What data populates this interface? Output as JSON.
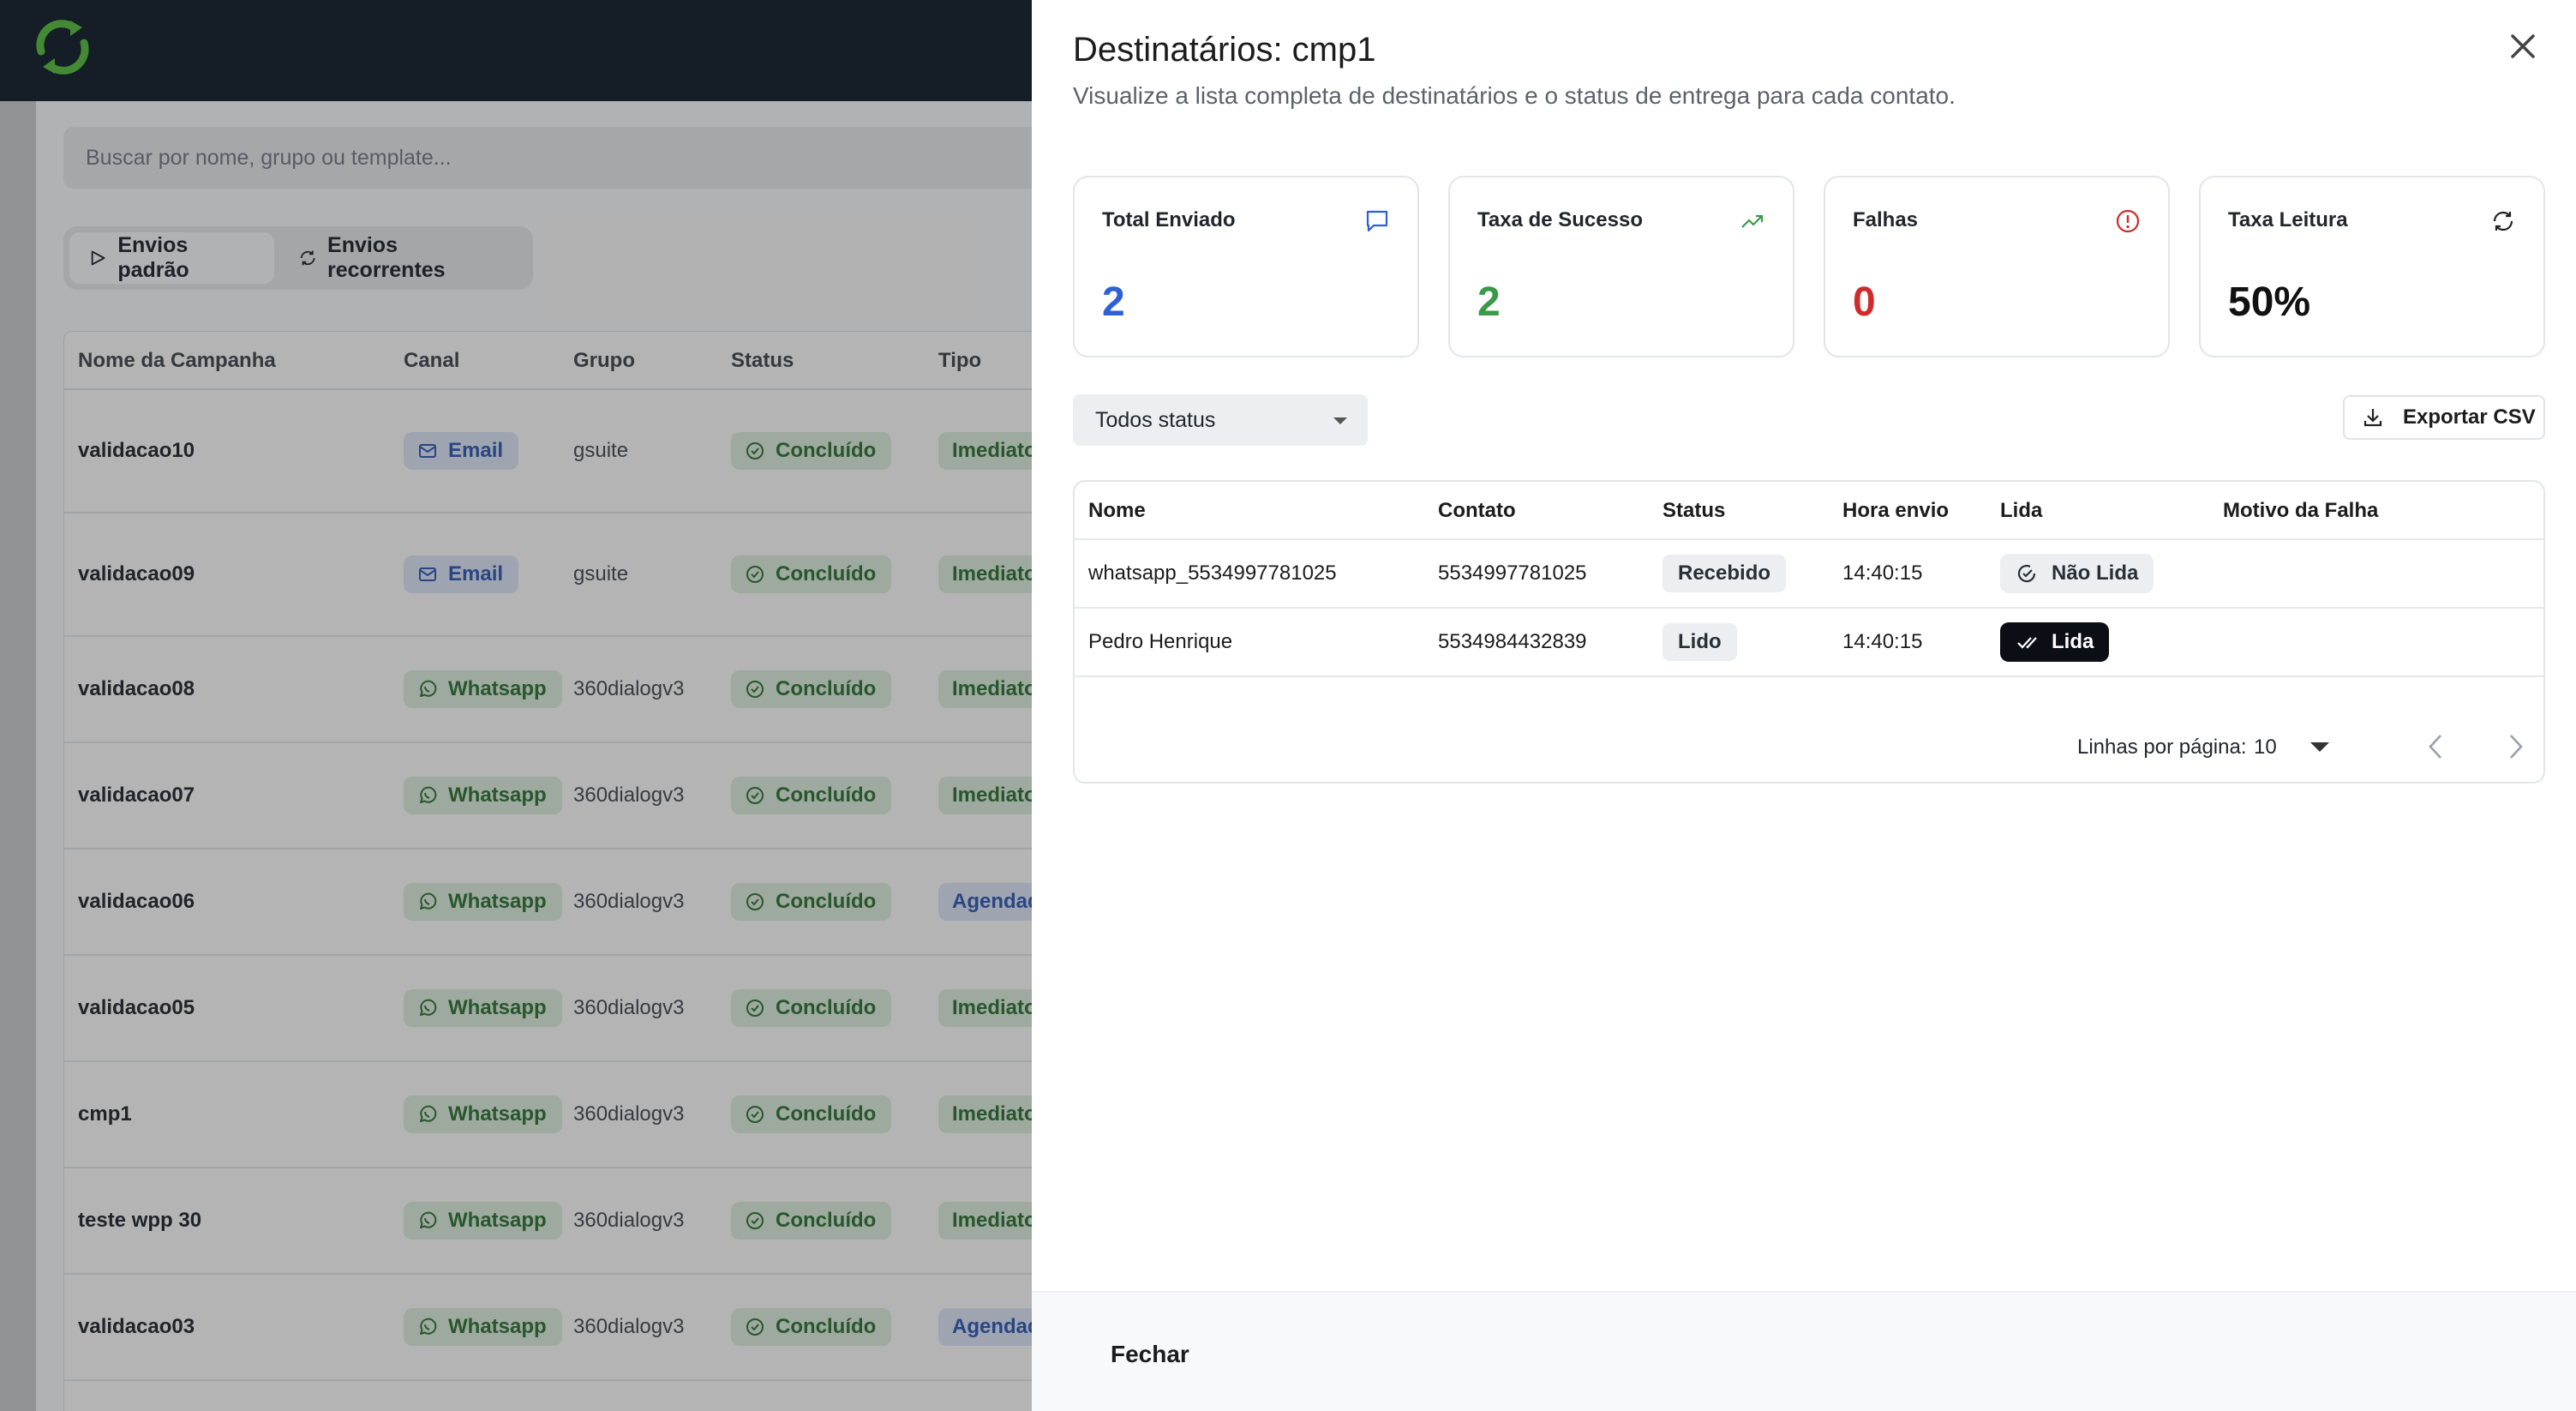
{
  "app": {
    "search_placeholder": "Buscar por nome, grupo ou template...",
    "tabs": [
      {
        "label": "Envios padrão",
        "icon": "send-icon"
      },
      {
        "label": "Envios recorrentes",
        "icon": "refresh-icon"
      }
    ],
    "columns": [
      "Nome da Campanha",
      "Canal",
      "Grupo",
      "Status",
      "Tipo"
    ],
    "rows": [
      {
        "name": "validacao10",
        "channel": "Email",
        "group": "gsuite",
        "status": "Concluído",
        "type": "Imediato"
      },
      {
        "name": "validacao09",
        "channel": "Email",
        "group": "gsuite",
        "status": "Concluído",
        "type": "Imediato"
      },
      {
        "name": "validacao08",
        "channel": "Whatsapp",
        "group": "360dialogv3",
        "status": "Concluído",
        "type": "Imediato"
      },
      {
        "name": "validacao07",
        "channel": "Whatsapp",
        "group": "360dialogv3",
        "status": "Concluído",
        "type": "Imediato"
      },
      {
        "name": "validacao06",
        "channel": "Whatsapp",
        "group": "360dialogv3",
        "status": "Concluído",
        "type": "Agendado"
      },
      {
        "name": "validacao05",
        "channel": "Whatsapp",
        "group": "360dialogv3",
        "status": "Concluído",
        "type": "Imediato"
      },
      {
        "name": "cmp1",
        "channel": "Whatsapp",
        "group": "360dialogv3",
        "status": "Concluído",
        "type": "Imediato"
      },
      {
        "name": "teste wpp 30",
        "channel": "Whatsapp",
        "group": "360dialogv3",
        "status": "Concluído",
        "type": "Imediato"
      },
      {
        "name": "validacao03",
        "channel": "Whatsapp",
        "group": "360dialogv3",
        "status": "Concluído",
        "type": "Agendado"
      }
    ]
  },
  "panel": {
    "title": "Destinatários: cmp1",
    "description": "Visualize a lista completa de destinatários e o status de entrega para cada contato.",
    "stats": [
      {
        "label": "Total Enviado",
        "value": "2",
        "color": "#2f5fd6",
        "icon": "message-icon"
      },
      {
        "label": "Taxa de Sucesso",
        "value": "2",
        "color": "#3a9a4a",
        "icon": "trending-up-icon"
      },
      {
        "label": "Falhas",
        "value": "0",
        "color": "#d12a2a",
        "icon": "alert-circle-icon"
      },
      {
        "label": "Taxa Leitura",
        "value": "50%",
        "color": "#111111",
        "icon": "refresh-icon"
      }
    ],
    "status_filter": "Todos status",
    "export_label": "Exportar CSV",
    "table_columns": [
      "Nome",
      "Contato",
      "Status",
      "Hora envio",
      "Lida",
      "Motivo da Falha"
    ],
    "recipients": [
      {
        "name": "whatsapp_5534997781025",
        "contact": "5534997781025",
        "status": "Recebido",
        "time": "14:40:15",
        "read": "Não Lida",
        "read_state": "unread",
        "reason": ""
      },
      {
        "name": "Pedro Henrique",
        "contact": "5534984432839",
        "status": "Lido",
        "time": "14:40:15",
        "read": "Lida",
        "read_state": "read",
        "reason": ""
      }
    ],
    "rows_per_page_label": "Linhas por página:",
    "rows_per_page_value": "10",
    "close_label": "Fechar"
  }
}
